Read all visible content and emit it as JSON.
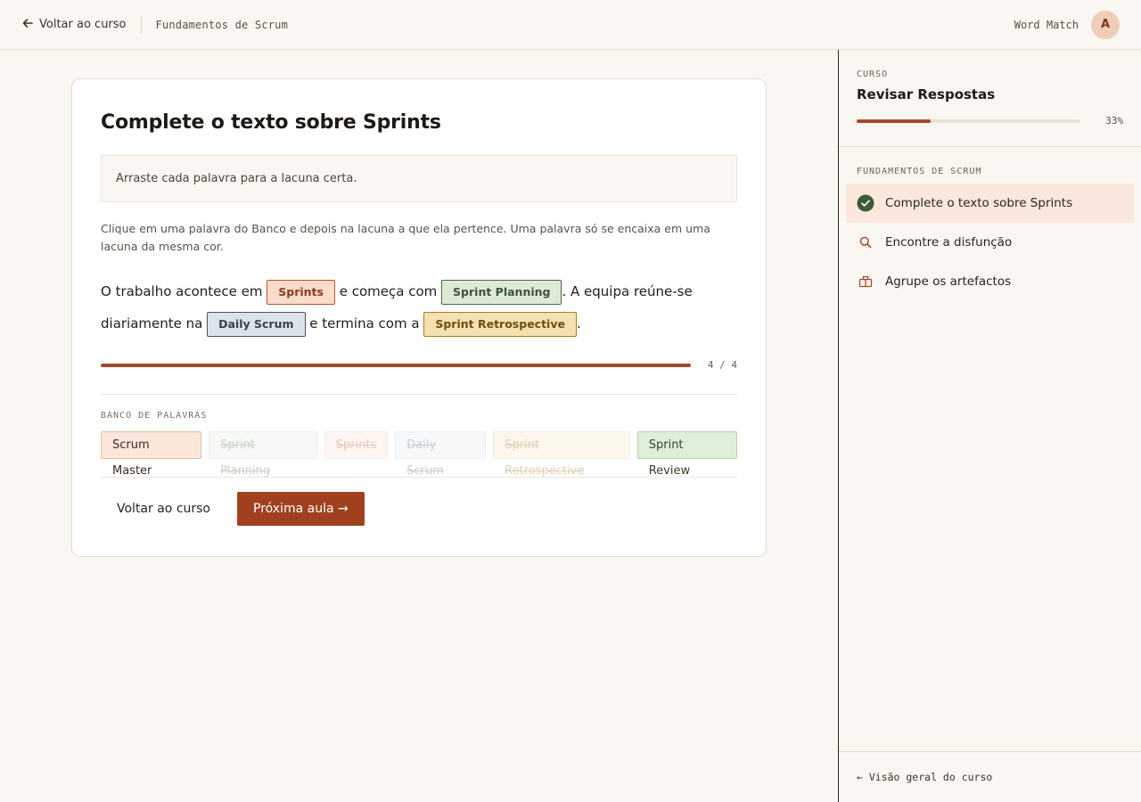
{
  "header": {
    "back_label": "Voltar ao curso",
    "course_name": "Fundamentos de Scrum",
    "mode_label": "Word Match",
    "avatar_initial": "A"
  },
  "exercise": {
    "title": "Complete o texto sobre Sprints",
    "instruction": "Arraste cada palavra para a lacuna certa.",
    "help": "Clique em uma palavra do Banco e depois na lacuna a que ela pertence. Uma palavra só se encaixa em uma lacuna da mesma cor.",
    "sentence": {
      "t1": "O trabalho acontece em",
      "b1": "Sprints",
      "t2": "e começa com",
      "b2": "Sprint Planning",
      "t3": ". A equipa reúne-se diariamente na",
      "b3": "Daily Scrum",
      "t4": "e termina com a",
      "b4": "Sprint Retrospective",
      "t5": "."
    },
    "progress": {
      "filled": 4,
      "total": 4,
      "fraction": 1.0,
      "label": "4 / 4"
    },
    "bank_label": "BANCO DE PALAVRAS",
    "bank": [
      {
        "word": "Scrum Master",
        "used": false,
        "color": "orange"
      },
      {
        "word": "Sprint Planning",
        "used": true,
        "color": "green"
      },
      {
        "word": "Sprints",
        "used": true,
        "color": "orange"
      },
      {
        "word": "Daily Scrum",
        "used": true,
        "color": "blue"
      },
      {
        "word": "Sprint Retrospective",
        "used": true,
        "color": "yellow"
      },
      {
        "word": "Sprint Review",
        "used": false,
        "color": "green"
      }
    ],
    "back_button": "Voltar ao curso",
    "next_button": "Próxima aula →"
  },
  "sidebar": {
    "kicker": "CURSO",
    "title": "Revisar Respostas",
    "progress_fraction": 0.33,
    "progress_label": "33%",
    "module_label": "FUNDAMENTOS DE SCRUM",
    "lessons": [
      {
        "label": "Complete o texto sobre Sprints",
        "icon": "check-circle-icon",
        "active": true
      },
      {
        "label": "Encontre a disfunção",
        "icon": "search-icon",
        "active": false
      },
      {
        "label": "Agrupe os artefactos",
        "icon": "grouping-icon",
        "active": false
      }
    ],
    "footer": "← Visão geral do curso"
  },
  "colors": {
    "accent": "#a0401f",
    "background": "#faf6f1",
    "success": "#4a6b3e"
  }
}
